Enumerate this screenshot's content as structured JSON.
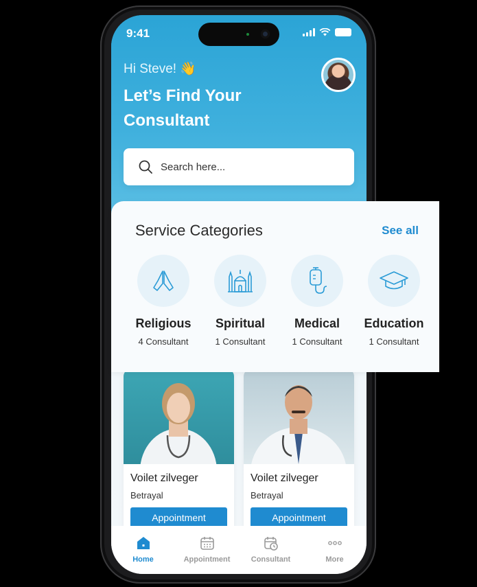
{
  "status": {
    "time": "9:41"
  },
  "header": {
    "greeting": "Hi Steve! 👋",
    "headline": "Let’s Find Your Consultant"
  },
  "search": {
    "placeholder": "Search here..."
  },
  "categories": {
    "title": "Service Categories",
    "see_all": "See all",
    "items": [
      {
        "name": "Religious",
        "count": "4 Consultant",
        "icon": "praying-hands-icon"
      },
      {
        "name": "Spiritual",
        "count": "1 Consultant",
        "icon": "mosque-icon"
      },
      {
        "name": "Medical",
        "count": "1 Consultant",
        "icon": "iv-drip-icon"
      },
      {
        "name": "Education",
        "count": "1 Consultant",
        "icon": "graduation-cap-icon"
      }
    ]
  },
  "consultants": [
    {
      "name": "Voilet zilveger",
      "subtitle": "Betrayal",
      "button": "Appointment"
    },
    {
      "name": "Voilet zilveger",
      "subtitle": "Betrayal",
      "button": "Appointment"
    }
  ],
  "tabbar": [
    {
      "label": "Home",
      "icon": "home-icon",
      "active": true
    },
    {
      "label": "Appointment",
      "icon": "calendar-icon",
      "active": false
    },
    {
      "label": "Consultant",
      "icon": "calendar-clock-icon",
      "active": false
    },
    {
      "label": "More",
      "icon": "more-dots-icon",
      "active": false
    }
  ],
  "colors": {
    "primary": "#1f8bd0",
    "header": "#2ba4d6",
    "icon_bg": "#e6f2f9"
  }
}
